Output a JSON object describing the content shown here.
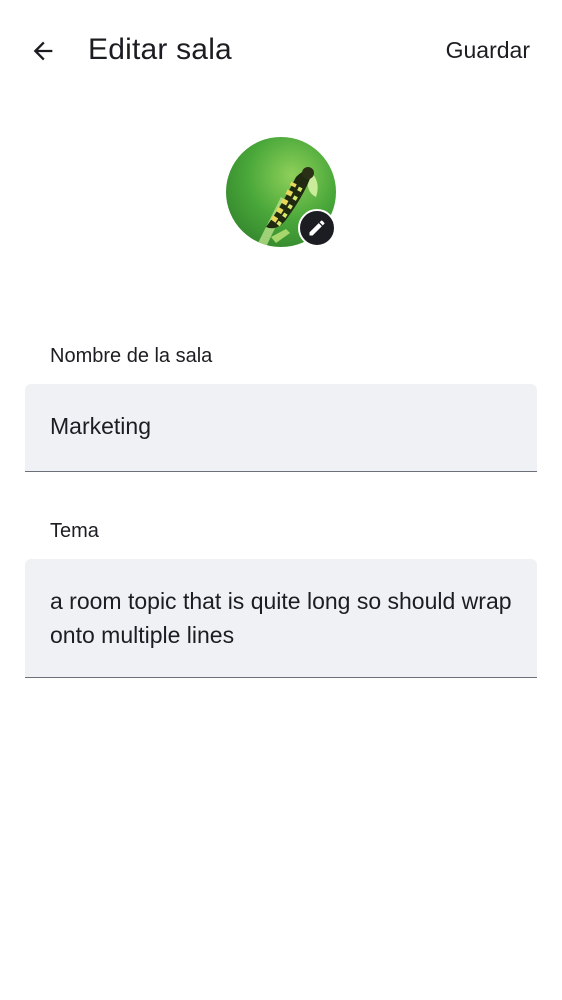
{
  "header": {
    "back_icon": "arrow-left-icon",
    "title": "Editar sala",
    "save_label": "Guardar"
  },
  "avatar": {
    "image": "caterpillar-photo",
    "edit_icon": "pencil-icon"
  },
  "room_name": {
    "label": "Nombre de la sala",
    "value": "Marketing"
  },
  "topic": {
    "label": "Tema",
    "value": "a room topic that is quite long so should wrap onto multiple lines"
  },
  "colors": {
    "text": "#1b1d22",
    "field_bg": "#f0f1f5",
    "field_underline": "#6b6f78",
    "badge_bg": "#1b1d22"
  }
}
